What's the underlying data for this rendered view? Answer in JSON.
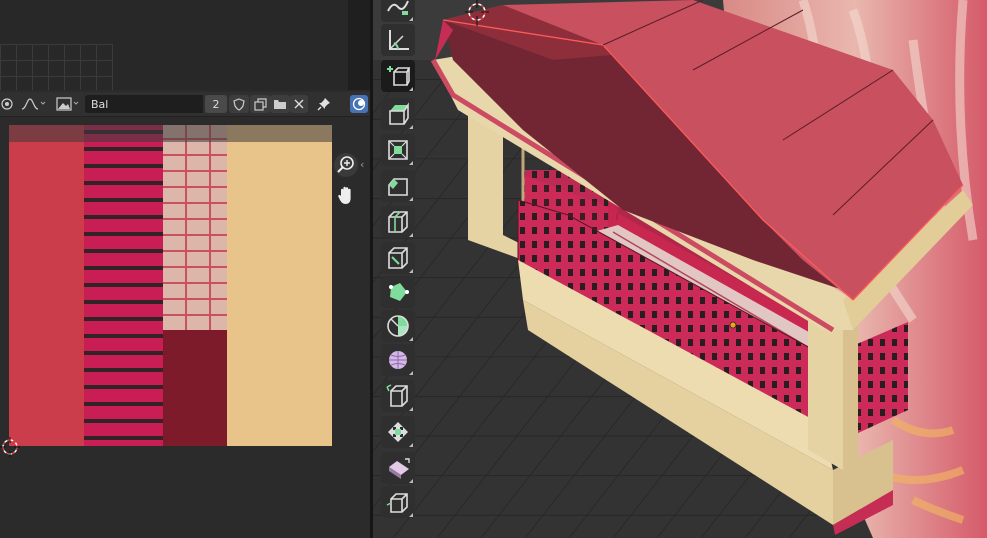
{
  "image_editor": {
    "image_name": "Bal",
    "users_count": "2",
    "collapse_chevron": "‹"
  },
  "toolbar": {
    "tools": [
      "annotate-tool",
      "measure-tool",
      "add-cube-tool",
      "extrude-region-tool",
      "inset-faces-tool",
      "bevel-tool",
      "loop-cut-tool",
      "knife-tool",
      "poly-build-tool",
      "spin-tool",
      "smooth-tool",
      "edge-slide-tool",
      "shrink-fatten-tool",
      "shear-tool",
      "rip-region-tool"
    ],
    "active_tool": "annotate-tool"
  },
  "colors": {
    "texture_red": "#cb3d4a",
    "texture_magenta": "#c81e55",
    "texture_wood": "#dcb6a8",
    "texture_dark": "#7e1b2a",
    "texture_sand": "#e8c38a",
    "roof": "#c9505f",
    "beam": "#e6d3a4",
    "grid_floor": "#303030",
    "overlay_button": "#4772b3"
  }
}
